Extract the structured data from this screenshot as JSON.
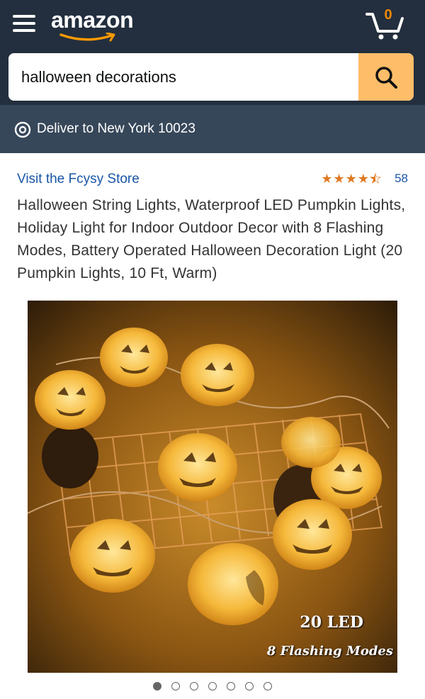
{
  "header": {
    "logo_text": "amazon",
    "cart_count": "0",
    "colors": {
      "header_bg": "#232f3e",
      "deliver_bg": "#37475a",
      "search_button": "#febd69",
      "cart_count": "#f08804"
    }
  },
  "search": {
    "value": "halloween decorations",
    "icon": "search-icon"
  },
  "delivery": {
    "text": "Deliver to New York 10023",
    "icon": "location-pin-icon"
  },
  "product": {
    "store_link": "Visit the Fcysy Store",
    "rating_value": 4.5,
    "rating_count": "58",
    "title": "Halloween String Lights, Waterproof LED Pumpkin Lights, Holiday Light for Indoor Outdoor Decor with 8 Flashing Modes, Battery Operated Halloween Decoration Light (20 Pumpkin Lights, 10 Ft, Warm)",
    "image": {
      "caption_line1": "20 LED",
      "caption_line2": "8 Flashing Modes"
    }
  },
  "carousel": {
    "total": 7,
    "active_index": 0
  }
}
